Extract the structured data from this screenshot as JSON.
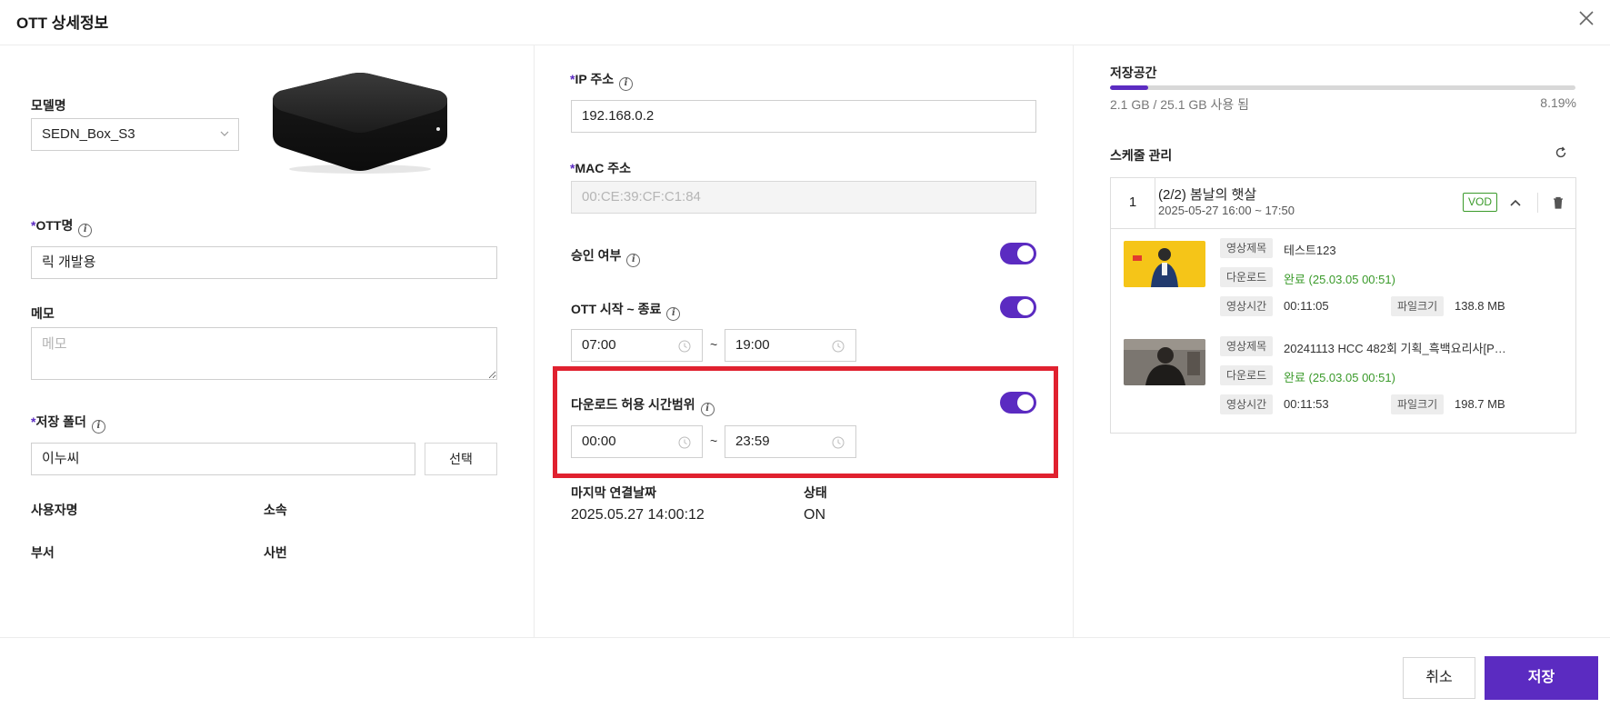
{
  "header": {
    "title": "OTT 상세정보"
  },
  "left": {
    "model_label": "모델명",
    "model_value": "SEDN_Box_S3",
    "ott_name_label": "OTT명",
    "ott_name_value": "릭 개발용",
    "memo_label": "메모",
    "memo_placeholder": "메모",
    "folder_label": "저장 폴더",
    "folder_value": "이누씨",
    "folder_button": "선택",
    "user_label": "사용자명",
    "affiliation_label": "소속",
    "dept_label": "부서",
    "emp_no_label": "사번"
  },
  "middle": {
    "ip_label": "IP 주소",
    "ip_value": "192.168.0.2",
    "mac_label": "MAC 주소",
    "mac_value": "00:CE:39:CF:C1:84",
    "approval_label": "승인 여부",
    "approval_on": true,
    "ott_time_label": "OTT 시작 ~ 종료",
    "ott_time_on": true,
    "ott_start": "07:00",
    "ott_end": "19:00",
    "download_label": "다운로드 허용 시간범위",
    "download_on": true,
    "download_start": "00:00",
    "download_end": "23:59",
    "tilde": "~",
    "last_conn_label": "마지막 연결날짜",
    "last_conn_value": "2025.05.27 14:00:12",
    "status_label": "상태",
    "status_value": "ON"
  },
  "right": {
    "storage_label": "저장공간",
    "storage_used_text": "2.1 GB / 25.1 GB 사용 됨",
    "storage_percent_text": "8.19%",
    "storage_fraction": 0.0819,
    "schedule_label": "스케줄 관리",
    "schedule": {
      "number": "1",
      "title": "(2/2) 봄날의 햇살",
      "time": "2025-05-27 16:00 ~ 17:50",
      "badge": "VOD",
      "items": [
        {
          "title_tag": "영상제목",
          "title": "테스트123",
          "download_tag": "다운로드",
          "download": "완료 (25.03.05 00:51)",
          "duration_tag": "영상시간",
          "duration": "00:11:05",
          "size_tag": "파일크기",
          "size": "138.8 MB"
        },
        {
          "title_tag": "영상제목",
          "title": "20241113 HCC 482회 기획_흑백요리사[P…",
          "download_tag": "다운로드",
          "download": "완료 (25.03.05 00:51)",
          "duration_tag": "영상시간",
          "duration": "00:11:53",
          "size_tag": "파일크기",
          "size": "198.7 MB"
        }
      ]
    }
  },
  "footer": {
    "cancel_label": "취소",
    "save_label": "저장"
  },
  "colors": {
    "accent": "#5b2bc1",
    "highlight": "#e0212f",
    "success": "#3a9a2a"
  }
}
